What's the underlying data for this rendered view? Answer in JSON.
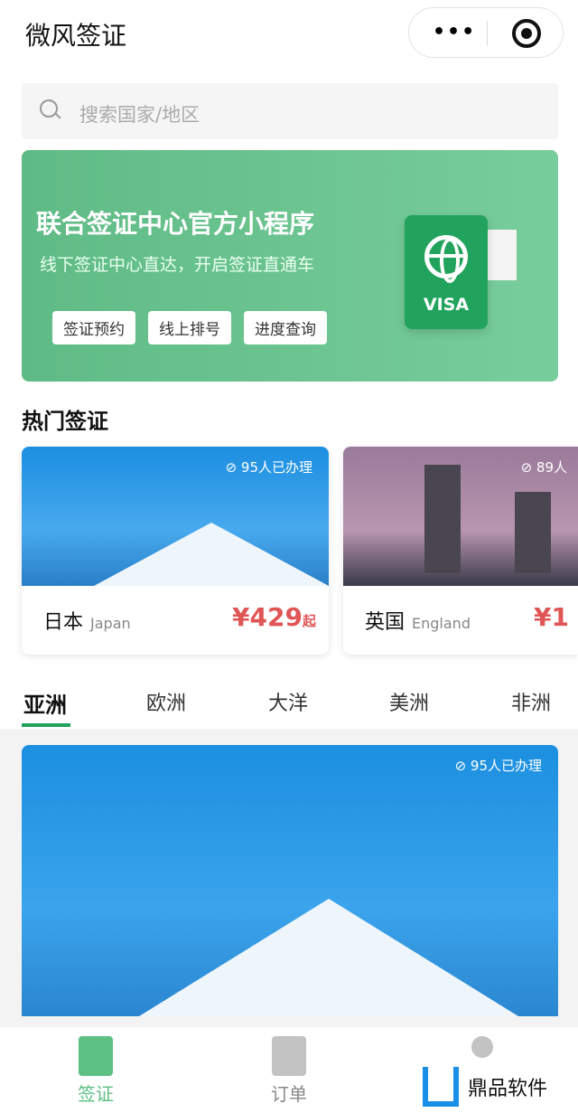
{
  "header": {
    "title": "微风签证",
    "more_icon": "more-dots-icon",
    "close_icon": "record-circle-icon"
  },
  "search": {
    "placeholder": "搜索国家/地区",
    "icon": "search-icon"
  },
  "banner": {
    "title": "联合签证中心官方小程序",
    "subtitle": "线下签证中心直达，开启签证直通车",
    "chips": [
      "签证预约",
      "线上排号",
      "进度查询"
    ],
    "visa_label": "VISA"
  },
  "hot": {
    "title": "热门签证",
    "cards": [
      {
        "name": "日本",
        "en": "Japan",
        "badge": "95人已办理",
        "price": "¥429",
        "suffix": "起"
      },
      {
        "name": "英国",
        "en": "England",
        "badge": "89人",
        "price": "¥1",
        "suffix": ""
      }
    ]
  },
  "regions": {
    "tabs": [
      "亚洲",
      "欧洲",
      "大洋",
      "美洲",
      "非洲"
    ],
    "active": 0
  },
  "featured": {
    "badge": "95人已办理"
  },
  "tabbar": {
    "items": [
      "签证",
      "订单"
    ],
    "active": 0
  },
  "watermark": "鼎品软件",
  "colors": {
    "accent": "#22a35d",
    "price": "#e05555"
  }
}
